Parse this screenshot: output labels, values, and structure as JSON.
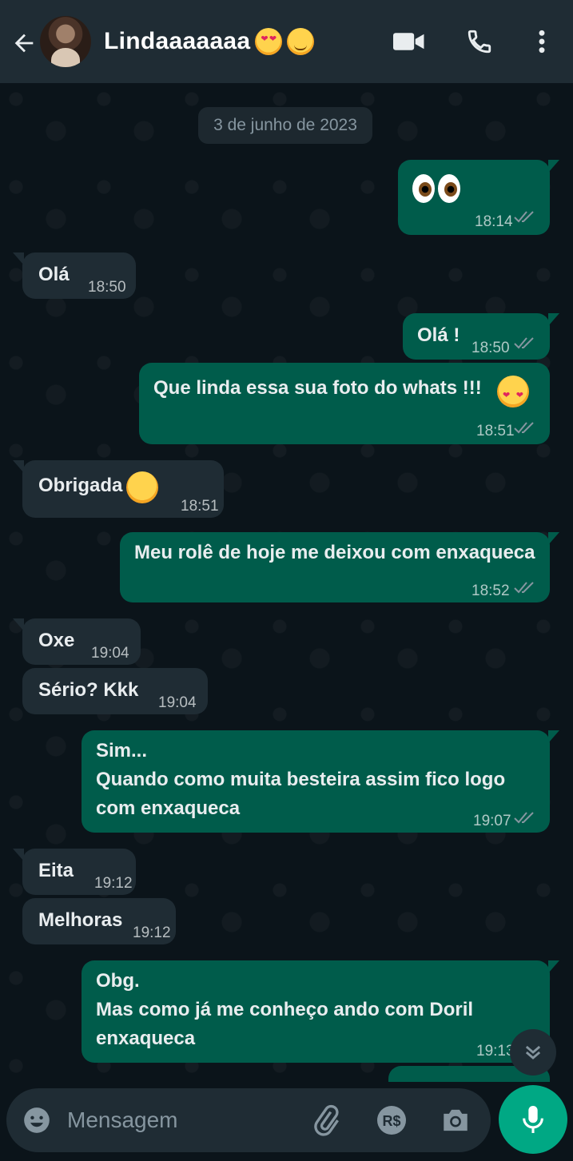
{
  "header": {
    "back_icon": "arrow-left-icon",
    "contact_name": "Lindaaaaaaa",
    "name_emojis": [
      "heart-eyes-emoji",
      "smirk-emoji"
    ],
    "video_icon": "video-camera-icon",
    "call_icon": "phone-icon",
    "more_icon": "more-vertical-icon"
  },
  "chat": {
    "date_label": "3 de junho de 2023",
    "messages": [
      {
        "dir": "out",
        "text": "",
        "emoji": "eyes-emoji",
        "time": "18:14",
        "read": true
      },
      {
        "dir": "in",
        "text": "Olá",
        "time": "18:50"
      },
      {
        "dir": "out",
        "text": "Olá !",
        "time": "18:50",
        "read": true
      },
      {
        "dir": "out",
        "text": "Que linda essa sua foto do whats !!!",
        "emoji": "smiling-face-with-hearts-emoji",
        "time": "18:51",
        "read": true
      },
      {
        "dir": "in",
        "text": "Obrigada",
        "emoji": "grinning-sweat-emoji",
        "time": "18:51"
      },
      {
        "dir": "out",
        "text": "Meu rolê de hoje me deixou com enxaqueca",
        "time": "18:52",
        "read": true
      },
      {
        "dir": "in",
        "text": "Oxe",
        "time": "19:04"
      },
      {
        "dir": "in",
        "text": "Sério? Kkk",
        "time": "19:04"
      },
      {
        "dir": "out",
        "lines": [
          "Sim...",
          "Quando como muita besteira assim fico logo",
          "com enxaqueca"
        ],
        "time": "19:07",
        "read": true
      },
      {
        "dir": "in",
        "text": "Eita",
        "time": "19:12"
      },
      {
        "dir": "in",
        "text": "Melhoras",
        "time": "19:12"
      },
      {
        "dir": "out",
        "lines": [
          "Obg.",
          "Mas como já me conheço ando com Doril",
          "enxaqueca"
        ],
        "time": "19:13"
      }
    ],
    "scroll_down_icon": "double-chevron-down-icon"
  },
  "composer": {
    "emoji_icon": "emoji-icon",
    "placeholder": "Mensagem",
    "attach_icon": "paperclip-icon",
    "payment_icon": "real-currency-icon",
    "payment_label": "R$",
    "camera_icon": "camera-icon",
    "mic_icon": "microphone-icon"
  },
  "colors": {
    "header_bg": "#1f2c34",
    "chat_bg": "#0b141a",
    "incoming_bubble": "#1f2c34",
    "outgoing_bubble": "#005c4b",
    "accent": "#00a884",
    "read_ticks": "#53bdeb"
  }
}
